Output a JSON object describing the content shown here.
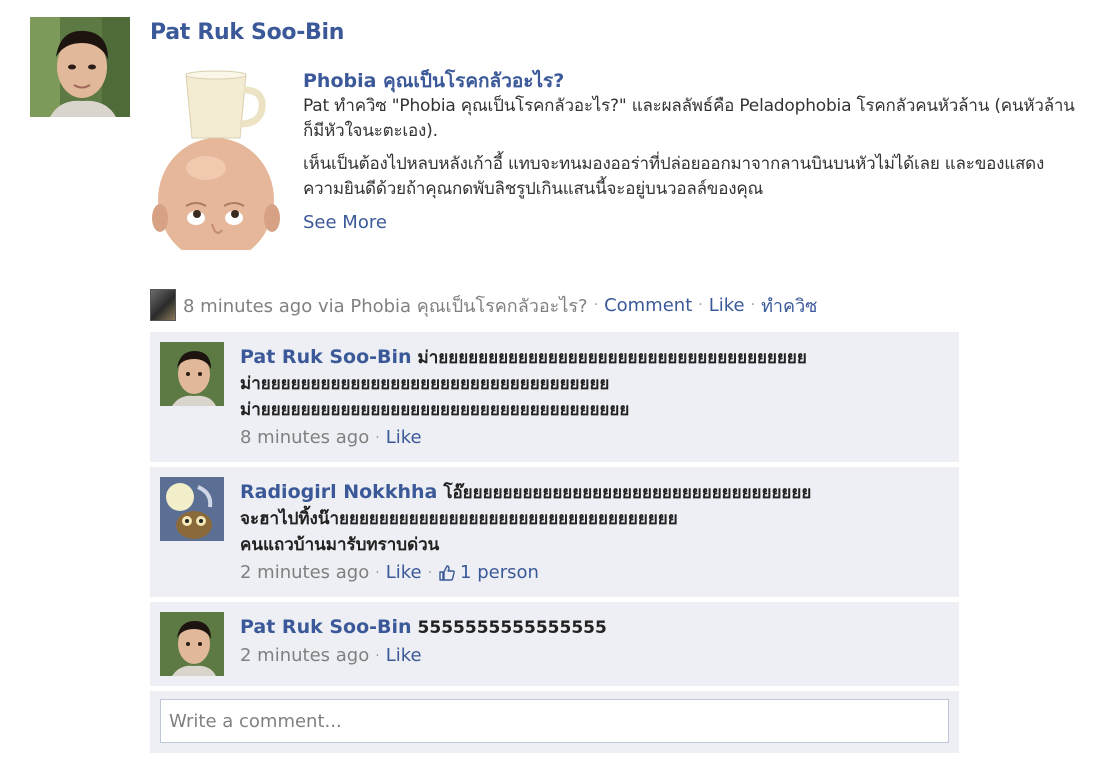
{
  "post": {
    "author": "Pat Ruk Soo-Bin",
    "attachment": {
      "title": "Phobia คุณเป็นโรคกลัวอะไร?",
      "caption": "Pat ทำควิซ \"Phobia คุณเป็นโรคกลัวอะไร?\" และผลลัพธ์คือ Peladophobia โรคกลัวคนหัวล้าน (คนหัวล้านก็มีหัวใจนะตะเอง).",
      "description": "เห็นเป็นต้องไปหลบหลังเก้าอี้ แทบจะทนมองออร่าที่ปล่อยออกมาจากลานบินบนหัวไม่ได้เลย และของแสดงความยินดีด้วยถ้าคุณกดพับลิชรูปเกินแสนนี้จะอยู่บนวอลล์ของคุณ",
      "see_more": "See More"
    },
    "meta": {
      "time_via": "8 minutes ago via Phobia คุณเป็นโรคกลัวอะไร?",
      "comment": "Comment",
      "like": "Like",
      "take_quiz": "ทำควิซ"
    }
  },
  "comments": [
    {
      "name": "Pat Ruk Soo-Bin",
      "lines": [
        "ม่ายยยยยยยยยยยยยยยยยยยยยยยยยยยยยยยยยยยยย",
        "ม่ายยยยยยยยยยยยยยยยยยยยยยยยยยยยยยยยยยย",
        "ม่ายยยยยยยยยยยยยยยยยยยยยยยยยยยยยยยยยยยยย"
      ],
      "time": "8 minutes ago",
      "like": "Like"
    },
    {
      "name": "Radiogirl Nokkhha",
      "lines": [
        "โอ๊ยยยยยยยยยยยยยยยยยยยยยยยยยยยยยยยยยยย",
        "จะฮาไปทิ้งน๊ายยยยยยยยยยยยยยยยยยยยยยยยยยยยยยยยยย",
        "คนแถวบ้านมารับทราบด่วน"
      ],
      "time": "2 minutes ago",
      "like": "Like",
      "likes_count": "1 person"
    },
    {
      "name": "Pat Ruk Soo-Bin",
      "lines": [
        "5555555555555555"
      ],
      "time": "2 minutes ago",
      "like": "Like"
    }
  ],
  "comment_box": {
    "placeholder": "Write a comment..."
  },
  "colors": {
    "link": "#3b5998",
    "comment_bg": "#edeff4",
    "meta_text": "#808080"
  }
}
